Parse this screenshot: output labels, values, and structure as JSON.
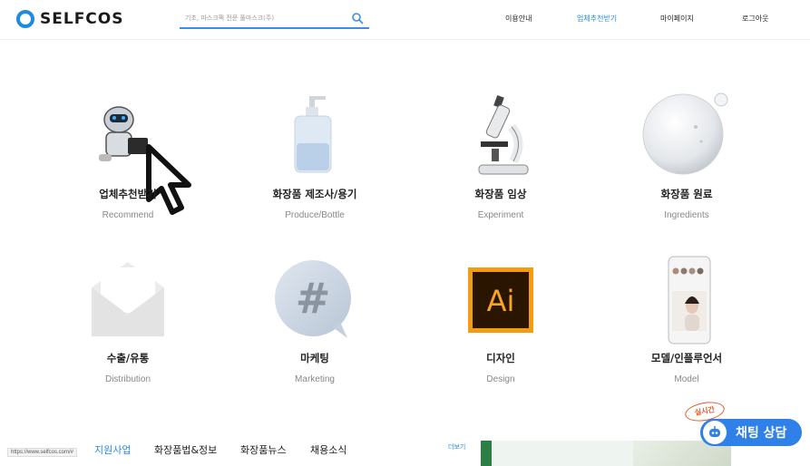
{
  "header": {
    "logo_text": "SELFCOS",
    "search_placeholder": "기초, 마스크팩 전문 풀마스크(주)",
    "nav": [
      "이용안내",
      "업체추천받기",
      "마이페이지",
      "로그아웃"
    ],
    "active_nav_index": 1
  },
  "categories": [
    {
      "title": "업체추천받기",
      "subtitle": "Recommend",
      "icon": "robot-icon"
    },
    {
      "title": "화장품 제조사/용기",
      "subtitle": "Produce/Bottle",
      "icon": "pump-bottle-icon"
    },
    {
      "title": "화장품 임상",
      "subtitle": "Experiment",
      "icon": "microscope-icon"
    },
    {
      "title": "화장품 원료",
      "subtitle": "Ingredients",
      "icon": "bubble-icon"
    },
    {
      "title": "수출/유통",
      "subtitle": "Distribution",
      "icon": "envelope-icon"
    },
    {
      "title": "마케팅",
      "subtitle": "Marketing",
      "icon": "hashtag-icon"
    },
    {
      "title": "디자인",
      "subtitle": "Design",
      "icon": "illustrator-icon"
    },
    {
      "title": "모델/인플루언서",
      "subtitle": "Model",
      "icon": "phone-model-icon"
    }
  ],
  "bottom": {
    "status_url": "https://www.selfcos.com/#",
    "tabs": [
      "지원사업",
      "화장품법&정보",
      "화장품뉴스",
      "채용소식"
    ],
    "active_tab_index": 0,
    "more_label": "더보기"
  },
  "chat": {
    "label": "채팅 상담",
    "live_tag": "실시간"
  },
  "colors": {
    "accent": "#2a8be0",
    "chat_bg": "#2f80e8",
    "live_tag": "#e25b2c"
  }
}
